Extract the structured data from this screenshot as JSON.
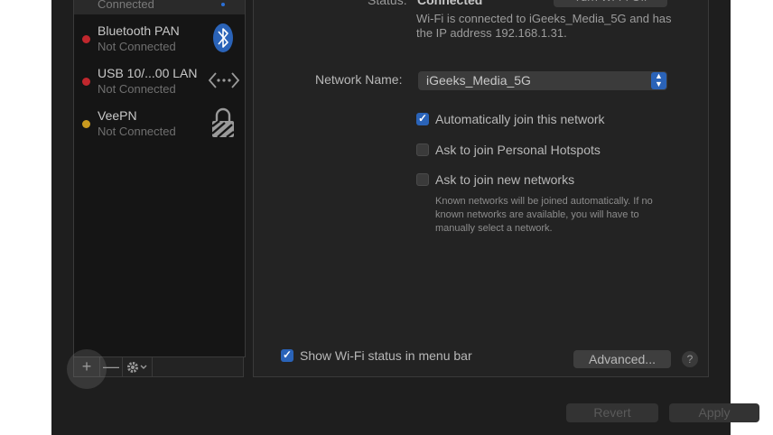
{
  "sidebar": {
    "selected_sub": "Connected",
    "items": [
      {
        "name": "Bluetooth PAN",
        "status": "Not Connected",
        "dot_color": "#c0272d",
        "icon": "bluetooth-icon"
      },
      {
        "name": "USB 10/...00 LAN",
        "status": "Not Connected",
        "dot_color": "#c0272d",
        "icon": "ethernet-icon"
      },
      {
        "name": "VeePN",
        "status": "Not Connected",
        "dot_color": "#c99a1f",
        "icon": "lock-icon"
      }
    ],
    "add_label": "+",
    "remove_label": "—",
    "gear_icon": "gear-icon"
  },
  "main": {
    "status_label": "Status:",
    "status_value": "Connected",
    "turn_off_label": "Turn Wi-Fi Off",
    "status_desc": "Wi-Fi is connected to iGeeks_Media_5G and has the IP address 192.168.1.31.",
    "network_name_label": "Network Name:",
    "network_name_value": "iGeeks_Media_5G",
    "options": [
      {
        "label": "Automatically join this network",
        "checked": true
      },
      {
        "label": "Ask to join Personal Hotspots",
        "checked": false
      },
      {
        "label": "Ask to join new networks",
        "checked": false
      }
    ],
    "hint": "Known networks will be joined automatically. If no known networks are available, you will have to manually select a network.",
    "show_status_label": "Show Wi-Fi status in menu bar",
    "advanced_label": "Advanced...",
    "help_label": "?"
  },
  "footer": {
    "revert_label": "Revert",
    "apply_label": "Apply"
  },
  "colors": {
    "accent": "#2a63b8",
    "background": "#1e1e1e"
  }
}
